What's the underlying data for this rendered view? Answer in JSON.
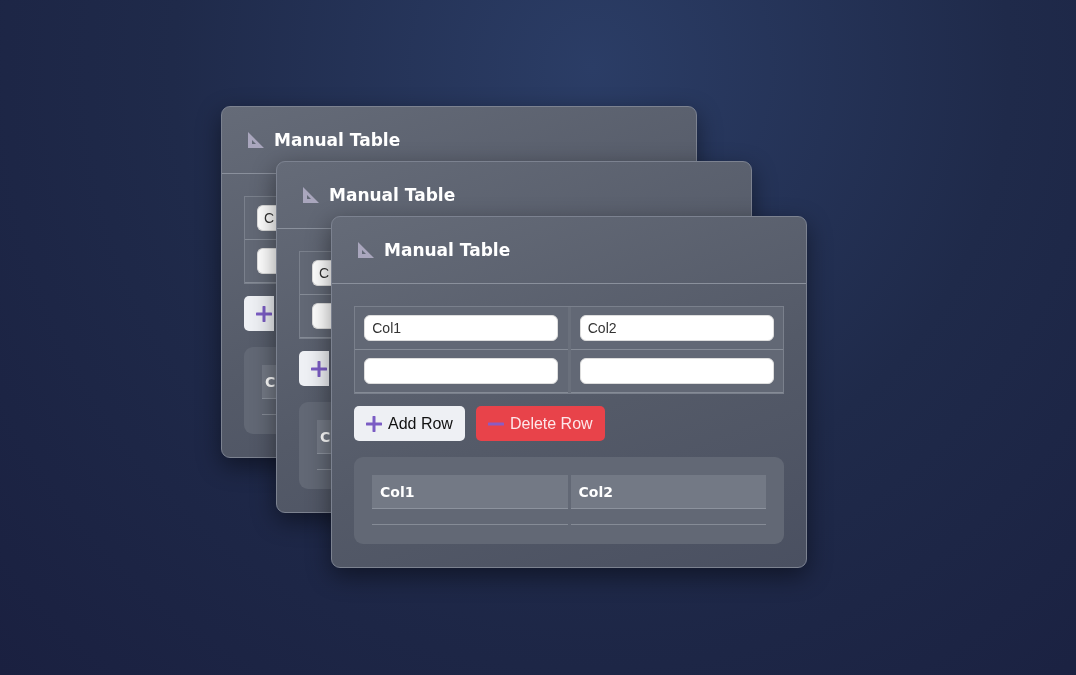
{
  "windows": [
    {
      "title": "Manual Table",
      "editor": {
        "rows": [
          {
            "cells": [
              {
                "value": "C"
              }
            ]
          },
          {
            "cells": [
              {}
            ]
          }
        ]
      },
      "buttons": [
        {
          "kind": "add"
        }
      ],
      "result": {
        "columns": [
          "C"
        ]
      }
    },
    {
      "title": "Manual Table",
      "editor": {
        "rows": [
          {
            "cells": [
              {
                "value": "C"
              }
            ]
          },
          {
            "cells": [
              {}
            ]
          }
        ]
      },
      "buttons": [
        {
          "kind": "add"
        }
      ],
      "result": {
        "columns": [
          "C"
        ]
      }
    },
    {
      "title": "Manual Table",
      "editor": {
        "rows": [
          {
            "cells": [
              {
                "value": "Col1"
              },
              {
                "value": "Col2"
              }
            ]
          },
          {
            "cells": [
              {},
              {}
            ]
          }
        ]
      },
      "buttons": [
        {
          "kind": "add",
          "label": "Add Row"
        },
        {
          "kind": "delete",
          "label": "Delete Row"
        }
      ],
      "result": {
        "columns": [
          "Col1",
          "Col2"
        ]
      }
    }
  ]
}
